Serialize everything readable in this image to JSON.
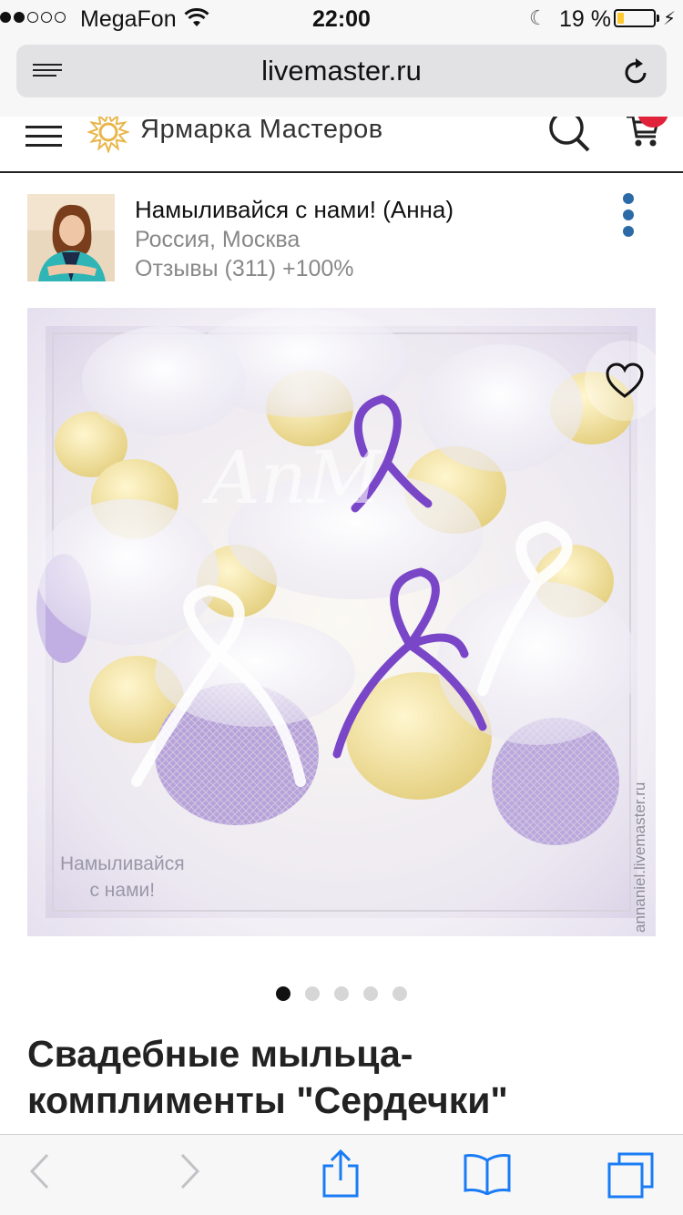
{
  "status_bar": {
    "carrier": "MegaFon",
    "time": "22:00",
    "battery_percent": "19 %",
    "battery_level": 0.19,
    "signal_bars_filled": 2,
    "signal_bars_total": 5
  },
  "browser": {
    "url": "livemaster.ru"
  },
  "site_header": {
    "logo_text": "Ярмарка Мастеров",
    "brand_color": "#e8b64a",
    "cart_badge_color": "#e0233a"
  },
  "seller": {
    "name": "Намыливайся с нами! (Анна)",
    "location": "Россия, Москва",
    "reviews": "Отзывы (311) +100%",
    "menu_dot_color": "#2b6aa6"
  },
  "product_image": {
    "overlay_text_line1": "Намыливайся",
    "overlay_text_line2": "с нами!",
    "side_watermark": "annaniel.livemaster.ru",
    "script_mark": "AnM"
  },
  "carousel": {
    "total": 5,
    "active_index": 0
  },
  "product": {
    "title": "Свадебные мыльца-комплименты \"Сердечки\""
  }
}
